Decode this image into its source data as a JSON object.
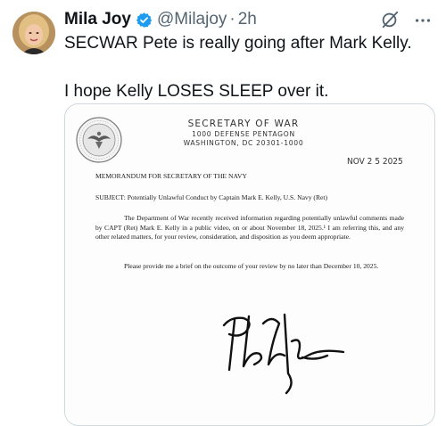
{
  "tweet": {
    "author_name": "Mila Joy",
    "handle": "@Milajoy",
    "separator": "·",
    "time": "2h",
    "text_line1": "SECWAR Pete is really going after Mark Kelly.",
    "text_line2": "I hope Kelly LOSES SLEEP over it.",
    "icons": {
      "verified": "verified-badge-icon",
      "grok": "grok-icon",
      "more": "more-icon"
    },
    "colors": {
      "verified": "#1d9bf0",
      "secondary_text": "#536471"
    }
  },
  "document": {
    "letterhead_title": "SECRETARY OF WAR",
    "letterhead_line2": "1000 DEFENSE PENTAGON",
    "letterhead_line3": "WASHINGTON, DC 20301-1000",
    "date_stamp": "NOV 2 5 2025",
    "memo_to": "MEMORANDUM FOR SECRETARY OF THE NAVY",
    "subject": "SUBJECT: Potentially Unlawful Conduct by Captain Mark E. Kelly, U.S. Navy (Ret)",
    "paragraph1": "The Department of War recently received information regarding potentially unlawful comments made by CAPT (Ret) Mark E. Kelly in a public video, on or about November 18, 2025.¹ I am referring this, and any other related matters, for your review, consideration, and disposition as you deem appropriate.",
    "paragraph2": "Please provide me a brief on the outcome of your review by no later than December 10, 2025."
  }
}
